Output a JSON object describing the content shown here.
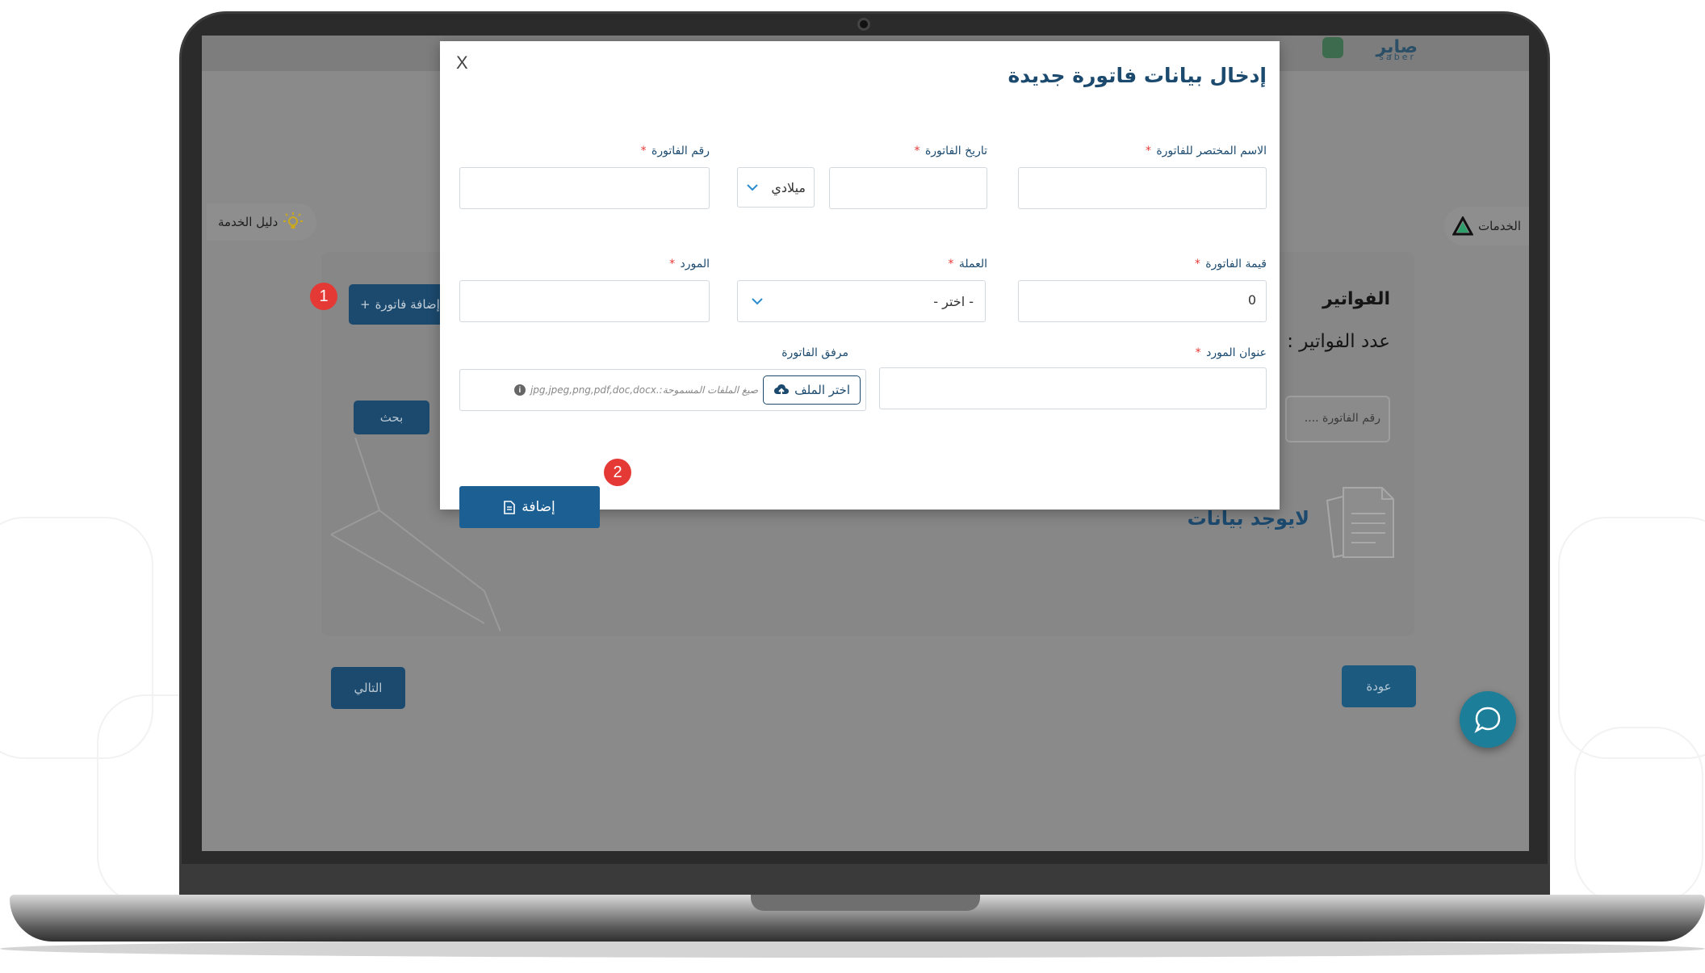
{
  "page": {
    "brand": {
      "name": "صابر",
      "sub": "saber"
    },
    "service_guide_label": "دليل الخدمة",
    "services_label": "الخدمات",
    "title": "الفواتير",
    "count_label": "عدد الفواتير :",
    "search_placeholder": "رقم الفاتورة ....",
    "search_button": "بحث",
    "add_invoice_button": "إضافة فاتورة",
    "add_invoice_plus": "+",
    "no_data_text": "لايوجد بيانات",
    "back_button": "عودة",
    "next_button": "التالي"
  },
  "modal": {
    "close": "X",
    "title": "إدخال بيانات فاتورة جديدة",
    "required_mark": "*",
    "fields": {
      "short_name_label": "الاسم المختصر للفاتورة",
      "invoice_date_label": "تاريخ الفاتورة",
      "calendar_value": "ميلادي",
      "invoice_number_label": "رقم الفاتورة",
      "invoice_value_label": "قيمة الفاتورة",
      "invoice_value": "0",
      "currency_label": "العملة",
      "currency_value": "- اختر -",
      "supplier_label": "المورد",
      "supplier_address_label": "عنوان المورد",
      "attachment_label": "مرفق الفاتورة",
      "choose_file_button": "اختر الملف",
      "allowed_formats_hint": "صيغ الملفات المسموحة:.jpg,jpeg,png,pdf,doc,docx"
    },
    "submit_button": "إضافة"
  },
  "steps": [
    "1",
    "2"
  ],
  "colors": {
    "primary": "#1c4a6e",
    "button": "#1c5f93",
    "badge": "#e53935",
    "required": "#e53935",
    "chat": "#1c7e98"
  },
  "icons": [
    "close-icon",
    "chevron-down-icon",
    "cloud-upload-icon",
    "info-icon",
    "document-icon",
    "lightbulb-icon",
    "triangle-logo-icon",
    "chat-icon"
  ]
}
